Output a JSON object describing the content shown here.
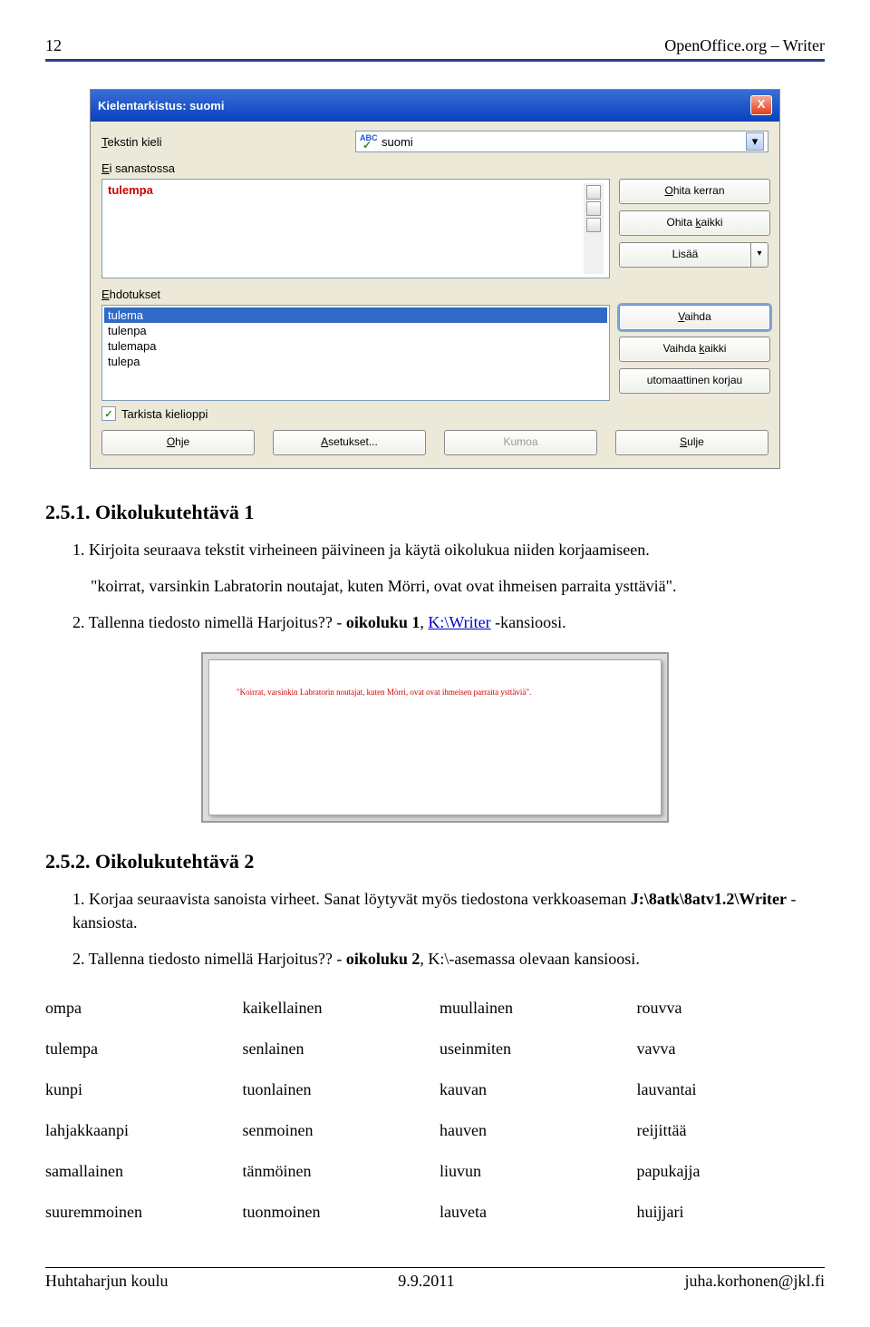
{
  "header": {
    "page_num": "12",
    "doc_title": "OpenOffice.org – Writer"
  },
  "dialog": {
    "title": "Kielentarkistus: suomi",
    "close_glyph": "X",
    "lang_label_pre": "T",
    "lang_label_post": "ekstin kieli",
    "lang_value": "suomi",
    "not_in_dict_pre": "E",
    "not_in_dict_post": "i sanastossa",
    "error_word": "tulempa",
    "suggestions_pre": "E",
    "suggestions_post": "hdotukset",
    "suggestions": [
      "tulema",
      "tulenpa",
      "tulemapa",
      "tulepa"
    ],
    "btn_ignore_once": "Ohita kerran",
    "btn_ignore_once_u": "O",
    "btn_ignore_all": "Ohita kaikki",
    "btn_ignore_all_u": "k",
    "btn_add": "Lisää",
    "btn_change": "Vaihda",
    "btn_change_u": "V",
    "btn_change_all": "Vaihda kaikki",
    "btn_change_all_u": "k",
    "btn_autocorrect": "utomaattinen korjau",
    "chk_grammar": "Tarkista kielioppi",
    "btn_help": "Ohje",
    "btn_help_u": "O",
    "btn_options": "Asetukset...",
    "btn_options_u": "A",
    "btn_undo": "Kumoa",
    "btn_close": "Sulje",
    "btn_close_u": "S"
  },
  "section1": {
    "title": "2.5.1. Oikolukutehtävä 1",
    "item1": "1. Kirjoita seuraava tekstit virheineen päivineen ja käytä oikolukua niiden korjaamiseen.",
    "quote": "\"koirrat, varsinkin Labratorin noutajat, kuten Mörri, ovat ovat ihmeisen parraita ysttäviä\".",
    "item2_pre": "2. Tallenna tiedosto nimellä Harjoitus?? - ",
    "item2_bold": "oikoluku 1",
    "item2_mid": ", ",
    "item2_link": "K:\\Writer",
    "item2_post": " -kansioosi."
  },
  "preview_text": "\"Koirrat, varsinkin Labratorin noutajat, kuten Mörri, ovat ovat ihmeisen parraita ysttäviä\".",
  "section2": {
    "title": "2.5.2. Oikolukutehtävä 2",
    "item1_pre": "1. Korjaa seuraavista sanoista virheet. Sanat löytyvät myös tiedostona verkkoaseman ",
    "item1_bold": "J:\\8atk\\8atv1.2\\Writer",
    "item1_post": " -kansiosta.",
    "item2_pre": "2. Tallenna tiedosto nimellä Harjoitus?? - ",
    "item2_bold": "oikoluku 2",
    "item2_post": ", K:\\-asemassa olevaan kansioosi."
  },
  "word_table": [
    [
      "ompa",
      "kaikellainen",
      "muullainen",
      "rouvva"
    ],
    [
      "tulempa",
      "senlainen",
      "useinmiten",
      "vavva"
    ],
    [
      "kunpi",
      "tuonlainen",
      "kauvan",
      "lauvantai"
    ],
    [
      "lahjakkaanpi",
      "senmoinen",
      "hauven",
      "reijittää"
    ],
    [
      "samallainen",
      "tänmöinen",
      "liuvun",
      "papukajja"
    ],
    [
      "suuremmoinen",
      "tuonmoinen",
      "lauveta",
      "huijjari"
    ]
  ],
  "footer": {
    "left": "Huhtaharjun koulu",
    "center": "9.9.2011",
    "right": "juha.korhonen@jkl.fi"
  }
}
